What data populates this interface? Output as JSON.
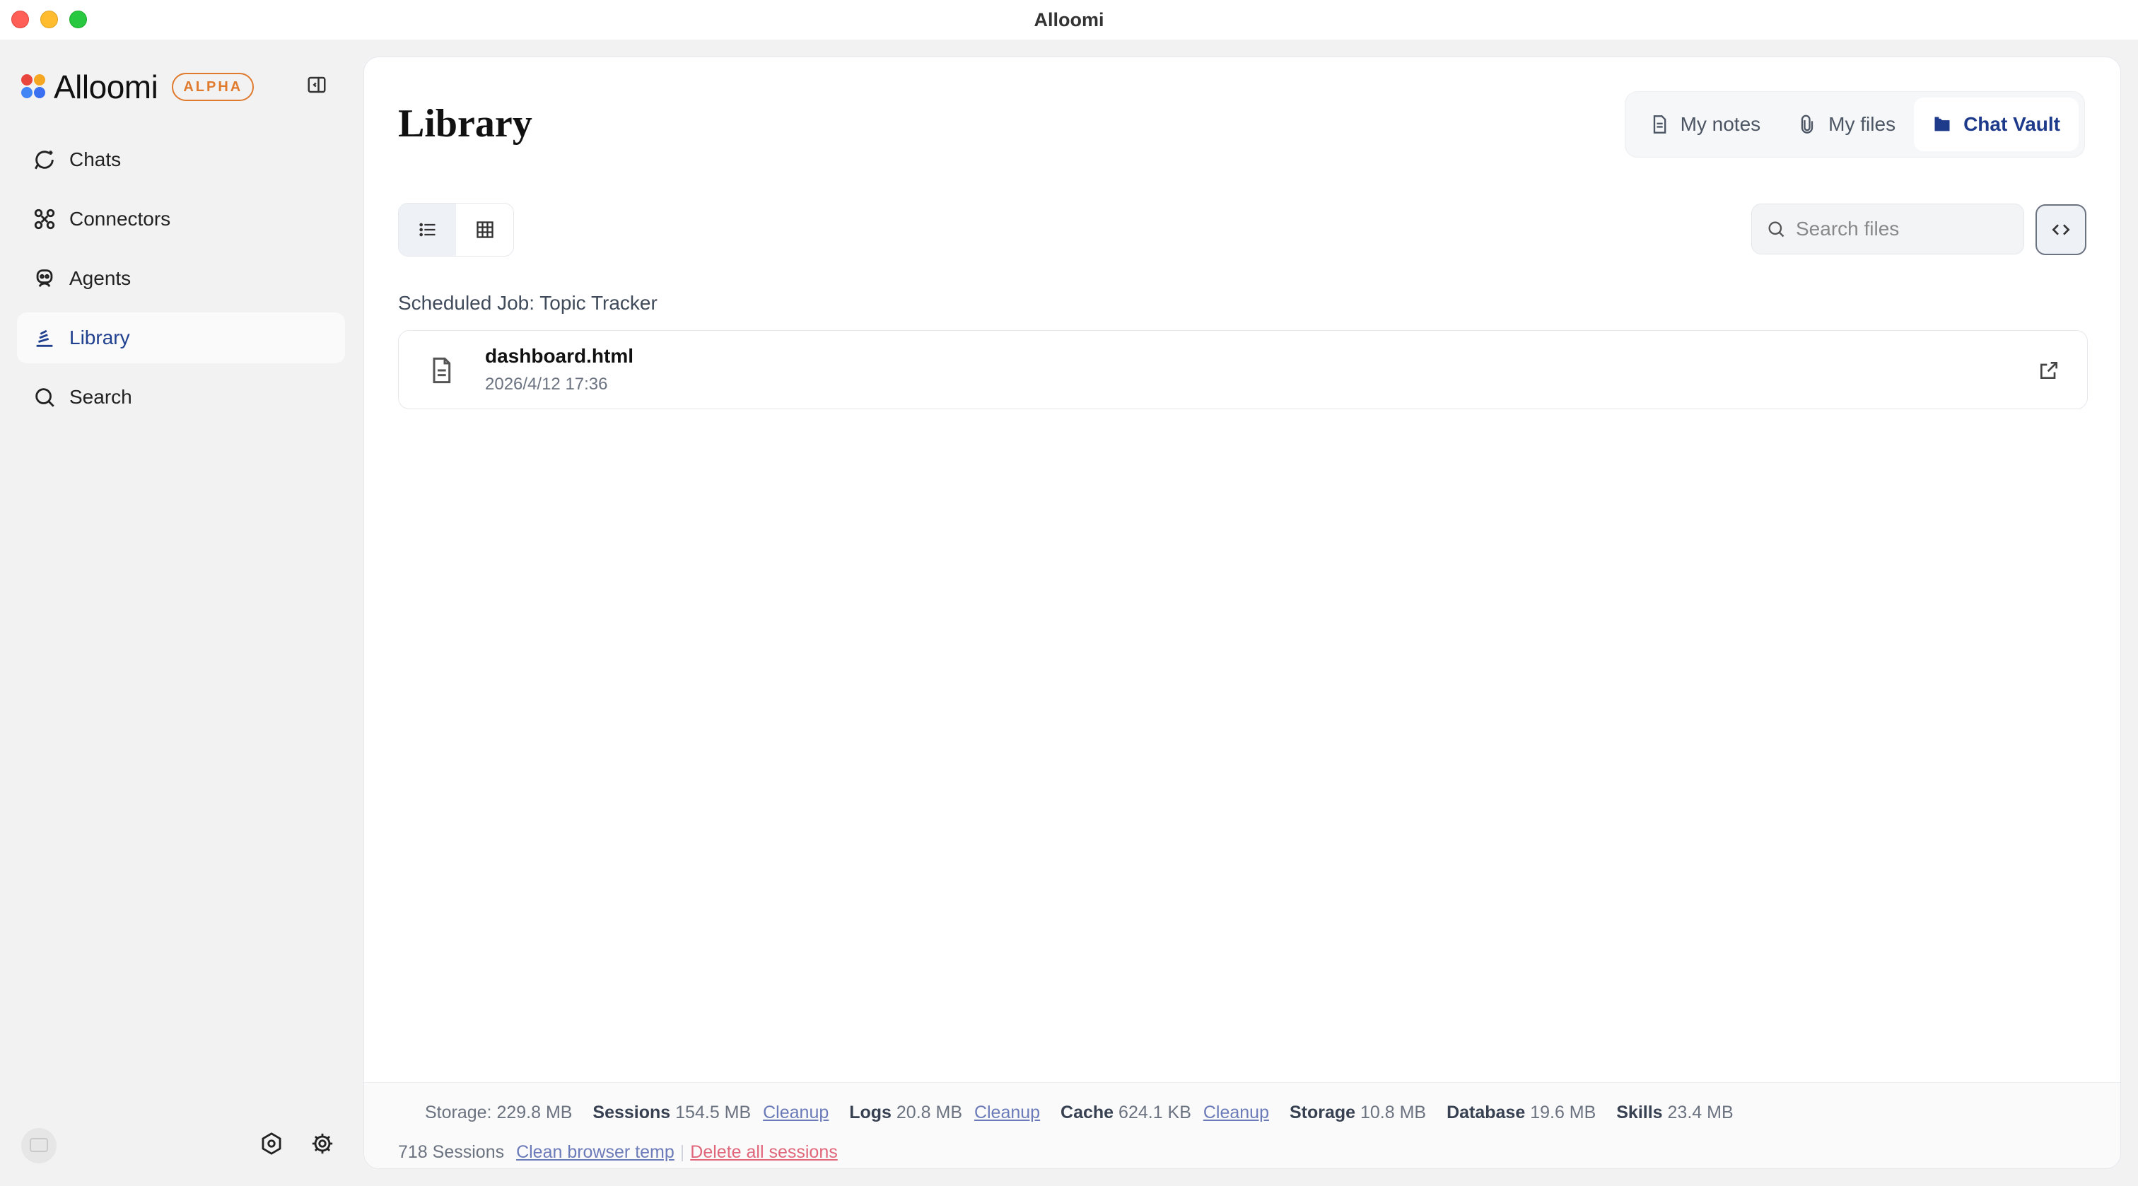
{
  "window": {
    "title": "Alloomi"
  },
  "sidebar": {
    "brand": "Alloomi",
    "badge": "ALPHA",
    "items": [
      {
        "label": "Chats",
        "icon": "chat-icon"
      },
      {
        "label": "Connectors",
        "icon": "connectors-icon"
      },
      {
        "label": "Agents",
        "icon": "agent-icon"
      },
      {
        "label": "Library",
        "icon": "library-icon",
        "active": true
      },
      {
        "label": "Search",
        "icon": "search-icon"
      }
    ]
  },
  "main": {
    "title": "Library",
    "tabs": [
      {
        "label": "My notes",
        "icon": "note-icon"
      },
      {
        "label": "My files",
        "icon": "paperclip-icon"
      },
      {
        "label": "Chat Vault",
        "icon": "folder-icon",
        "active": true
      }
    ],
    "search": {
      "placeholder": "Search files"
    },
    "group_title": "Scheduled Job: Topic Tracker",
    "files": [
      {
        "name": "dashboard.html",
        "date": "2026/4/12 17:36"
      }
    ]
  },
  "footer": {
    "storage_total": "Storage: 229.8 MB",
    "sessions_label": "Sessions",
    "sessions_value": "154.5 MB",
    "logs_label": "Logs",
    "logs_value": "20.8 MB",
    "cache_label": "Cache",
    "cache_value": "624.1 KB",
    "storage_label": "Storage",
    "storage_value": "10.8 MB",
    "database_label": "Database",
    "database_value": "19.6 MB",
    "skills_label": "Skills",
    "skills_value": "23.4 MB",
    "cleanup": "Cleanup",
    "sessions_count": "718 Sessions",
    "clean_browser_temp": "Clean browser temp",
    "delete_all_sessions": "Delete all sessions"
  },
  "colors": {
    "accent": "#1e3a8a",
    "badge": "#e07a2d",
    "danger": "#e0667a"
  }
}
